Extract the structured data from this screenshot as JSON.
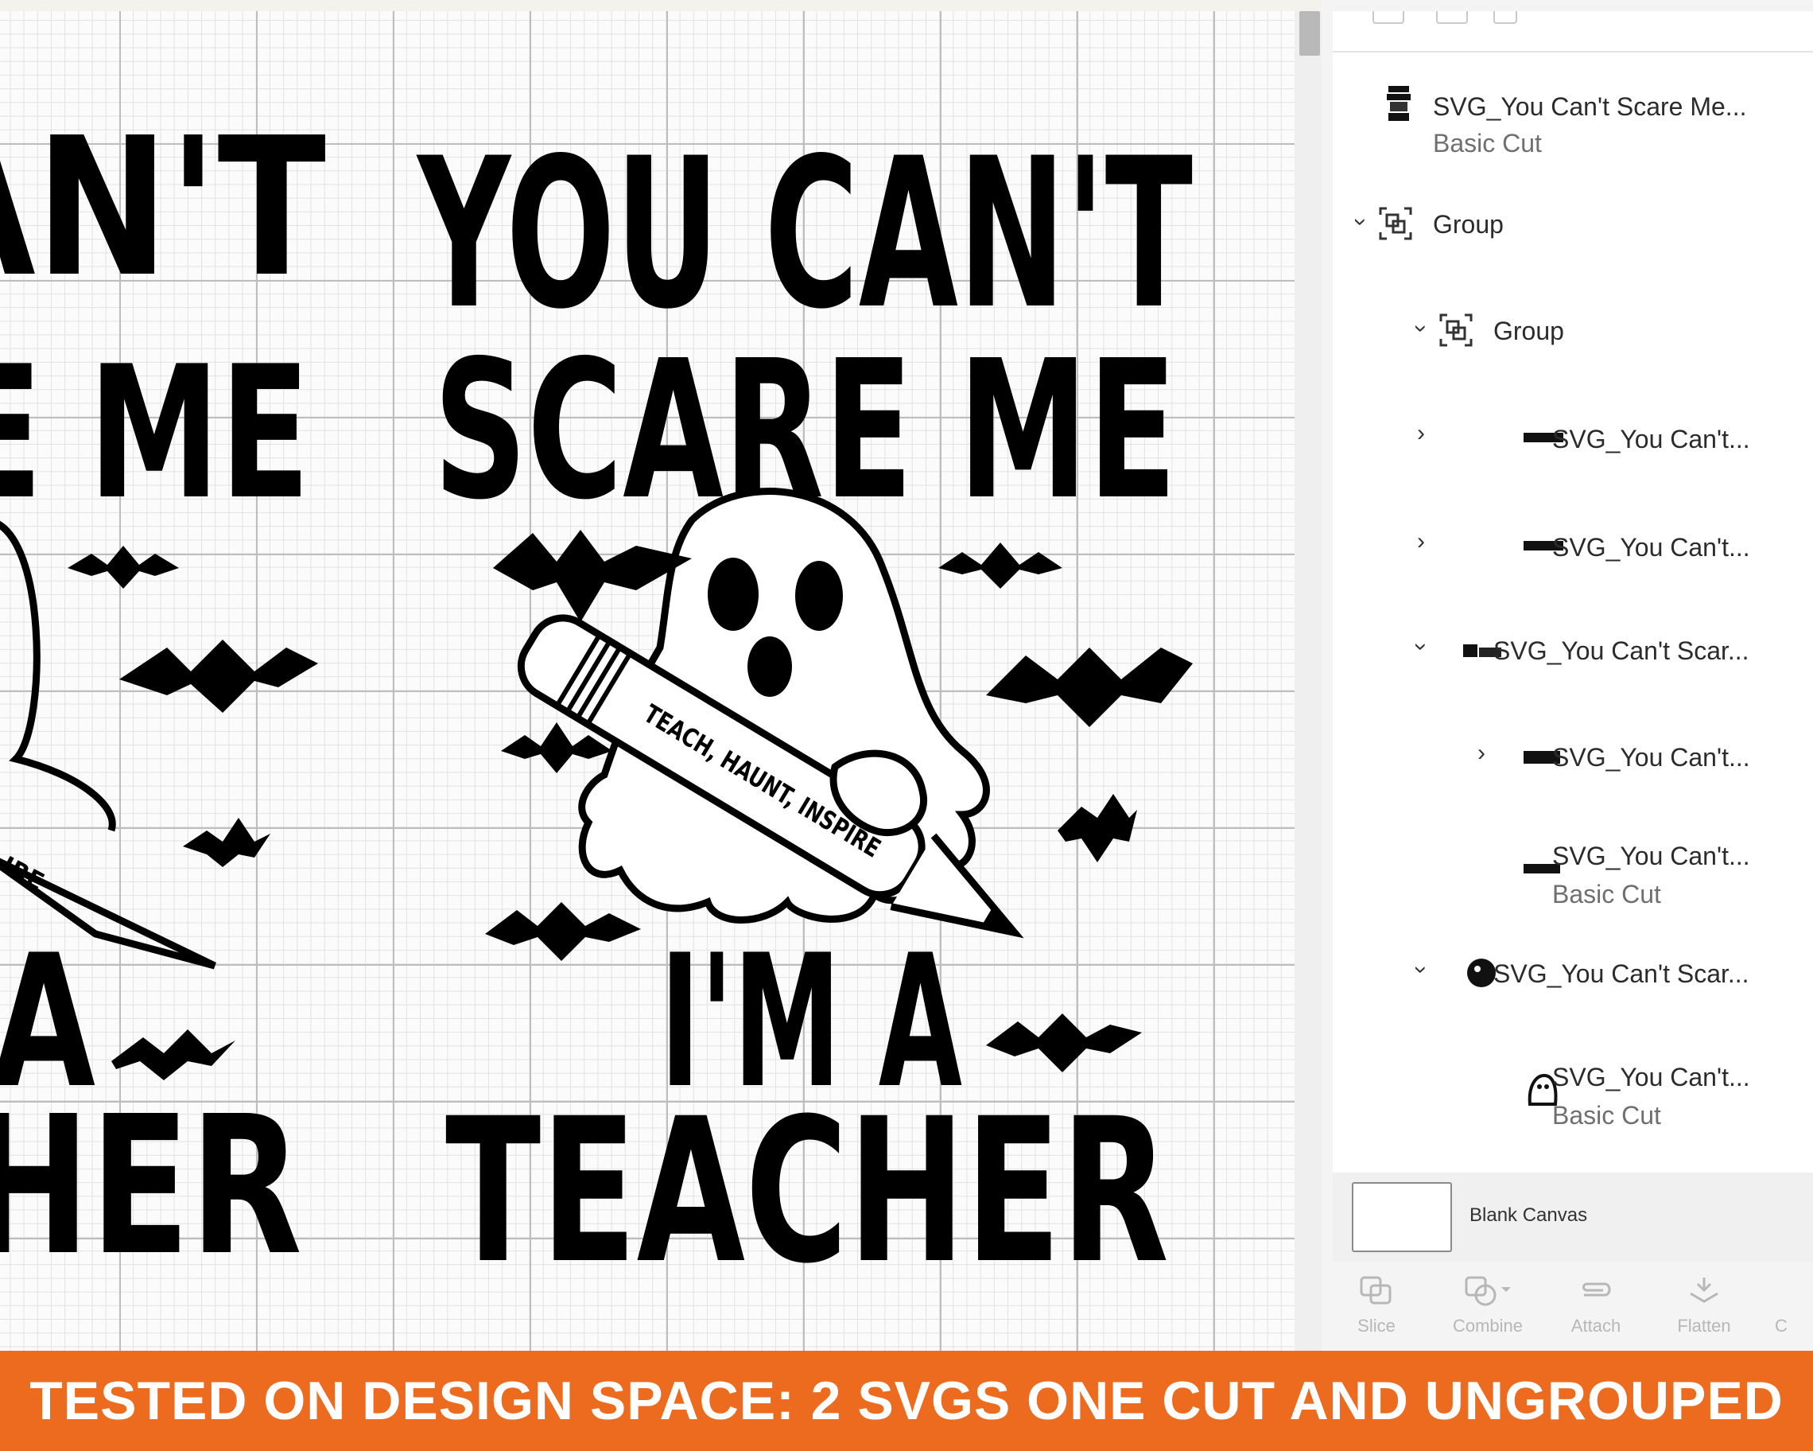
{
  "design": {
    "line1": "YOU CAN'T",
    "line2": "SCARE ME",
    "pencil_text": "TEACH, HAUNT, INSPIRE",
    "line3": "I'M A",
    "line4": "TEACHER",
    "left_line1": "AN'T",
    "left_line2": "E ME",
    "left_line3": "A",
    "left_line4": "HER",
    "left_pencil": "IRE"
  },
  "layers": {
    "items": [
      {
        "name": "SVG_You Can't Scare Me...",
        "sub": "Basic Cut",
        "thumb": "layer-thumbnail"
      },
      {
        "name": "Group",
        "icon": "group-icon",
        "expanded": true
      },
      {
        "name": "Group",
        "icon": "group-icon",
        "expanded": true
      },
      {
        "name": "SVG_You Can't...",
        "thumb": "layer-thumbnail",
        "expanded": false
      },
      {
        "name": "SVG_You Can't...",
        "thumb": "layer-thumbnail",
        "expanded": false
      },
      {
        "name": "SVG_You Can't Scar...",
        "thumb": "layer-thumbnail",
        "expanded": true
      },
      {
        "name": "SVG_You Can't...",
        "thumb": "layer-thumbnail",
        "expanded": false
      },
      {
        "name": "SVG_You Can't...",
        "sub": "Basic Cut",
        "thumb": "layer-thumbnail"
      },
      {
        "name": "SVG_You Can't Scar...",
        "thumb": "layer-thumbnail",
        "expanded": true
      },
      {
        "name": "SVG_You Can't...",
        "sub": "Basic Cut",
        "thumb": "layer-thumbnail"
      }
    ]
  },
  "blank_canvas": {
    "label": "Blank Canvas"
  },
  "toolbar": {
    "slice": "Slice",
    "combine": "Combine",
    "attach": "Attach",
    "flatten": "Flatten",
    "more": "C"
  },
  "banner": {
    "text": "TESTED ON DESIGN SPACE: 2 SVGS ONE CUT AND UNGROUPED"
  },
  "colors": {
    "banner": "#ec6b1f",
    "grid_major": "#bdbdbd",
    "grid_minor": "#e2e2e2"
  }
}
